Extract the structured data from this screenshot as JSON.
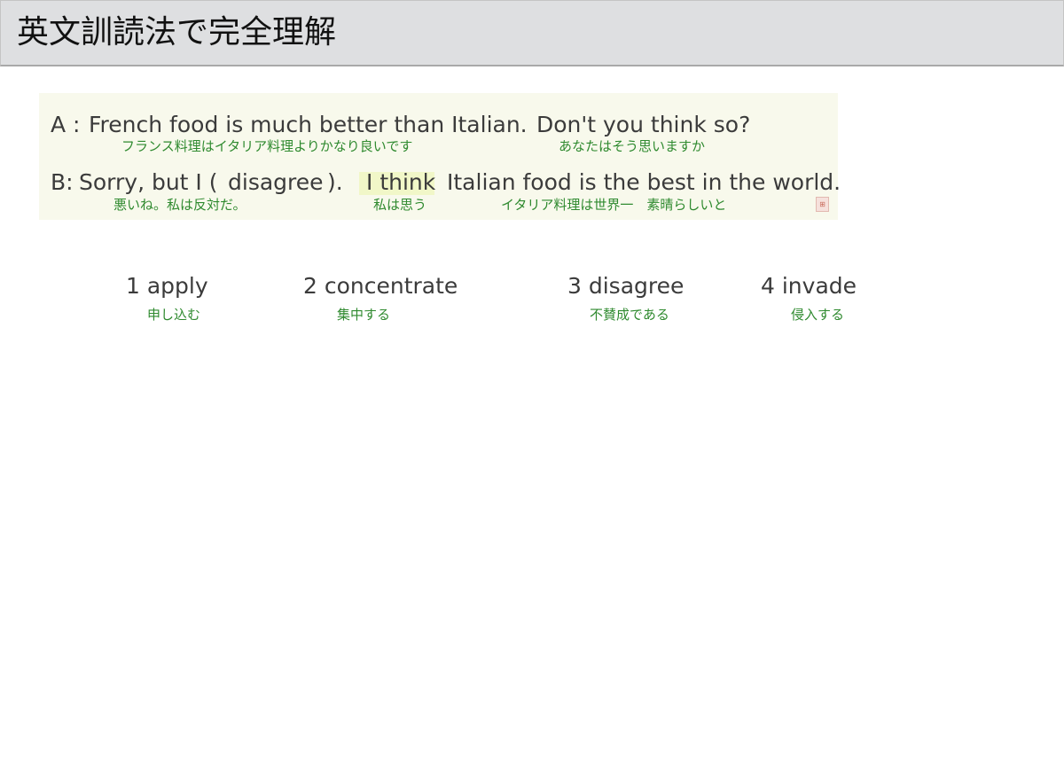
{
  "header": {
    "title": "英文訓読法で完全理解"
  },
  "dialog": {
    "line_a": {
      "speaker": "A :",
      "sentence1": "French food is much better than Italian.",
      "sentence2": "Don't you think so?",
      "gloss1": "フランス料理はイタリア料理よりかなり良いです",
      "gloss2": "あなたはそう思いますか"
    },
    "line_b": {
      "speaker": "B:",
      "part1": "Sorry, but I (",
      "answer": "disagree",
      "close": ").",
      "highlight": "I think",
      "part2": "Italian food is the best in the world.",
      "gloss1": "悪いね。私は反対だ。",
      "gloss2": "私は思う",
      "gloss3": "イタリア料理は世界一　素晴らしいと"
    }
  },
  "options": [
    {
      "label": "1 apply",
      "gloss": "申し込む"
    },
    {
      "label": "2 concentrate",
      "gloss": "集中する"
    },
    {
      "label": "3 disagree",
      "gloss": "不賛成である"
    },
    {
      "label": "4 invade",
      "gloss": "侵入する"
    }
  ]
}
